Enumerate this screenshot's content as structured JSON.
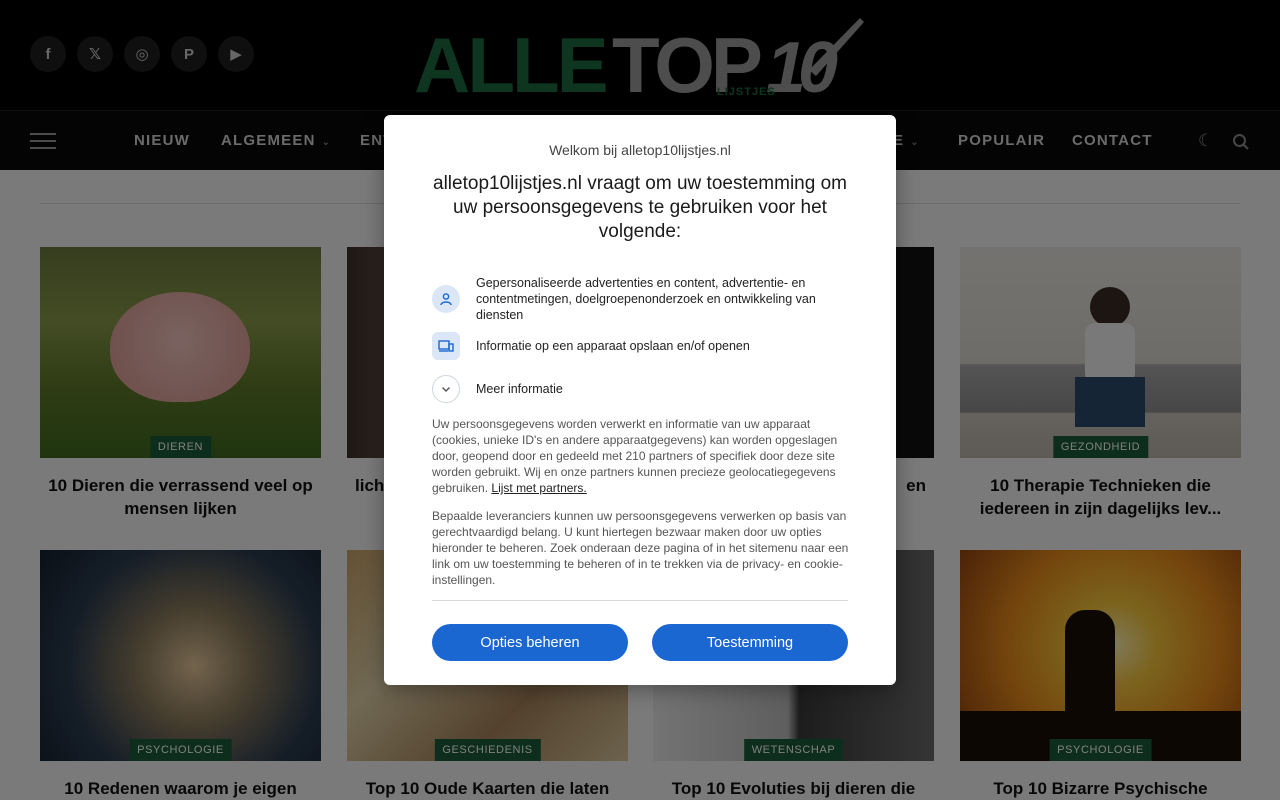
{
  "header": {
    "social": [
      {
        "icon": "facebook-icon",
        "glyph": "f"
      },
      {
        "icon": "x-twitter-icon",
        "glyph": "𝕏"
      },
      {
        "icon": "instagram-icon",
        "glyph": "◎"
      },
      {
        "icon": "pinterest-icon",
        "glyph": "P"
      },
      {
        "icon": "youtube-icon",
        "glyph": "▶"
      }
    ],
    "logo": {
      "part1": "ALLE",
      "part2": "TOP",
      "part3": "10",
      "sub": "LIJSTJES",
      "color_green": "#1d6b3f",
      "color_grey": "#9a9a9a"
    }
  },
  "nav": {
    "items": [
      "NIEUW",
      "ALGEMEEN",
      "ENT",
      "E",
      "POPULAIR",
      "CONTACT"
    ],
    "dark_mode_icon": "moon-icon",
    "search_icon": "search-icon"
  },
  "cards": [
    {
      "category": "DIEREN",
      "title": "10 Dieren die verrassend veel op mensen lijken"
    },
    {
      "category": "",
      "title": "lich"
    },
    {
      "category": "",
      "title": "en"
    },
    {
      "category": "GEZONDHEID",
      "title": "10 Therapie Technieken die iedereen in zijn dagelijks lev..."
    },
    {
      "category": "PSYCHOLOGIE",
      "title": "10 Redenen waarom je eigen"
    },
    {
      "category": "GESCHIEDENIS",
      "title": "Top 10 Oude Kaarten die laten"
    },
    {
      "category": "WETENSCHAP",
      "title": "Top 10 Evoluties bij dieren die"
    },
    {
      "category": "PSYCHOLOGIE",
      "title": "Top 10 Bizarre Psychische"
    }
  ],
  "consent": {
    "welcome": "Welkom bij alletop10lijstjes.nl",
    "heading": "alletop10lijstjes.nl vraagt om uw toestemming om uw persoonsgegevens te gebruiken voor het volgende:",
    "purposes": [
      {
        "icon": "person-icon",
        "text": "Gepersonaliseerde advertenties en content, advertentie- en contentmetingen, doelgroepenonderzoek en ontwikkeling van diensten"
      },
      {
        "icon": "devices-icon",
        "text": "Informatie op een apparaat opslaan en/of openen"
      },
      {
        "icon": "chevron-down-icon",
        "text": "Meer informatie"
      }
    ],
    "body1": "Uw persoonsgegevens worden verwerkt en informatie van uw apparaat (cookies, unieke ID's en andere apparaatgegevens) kan worden opgeslagen door, geopend door en gedeeld met 210 partners of specifiek door deze site worden gebruikt. Wij en onze partners kunnen precieze geolocatiegegevens gebruiken.",
    "partners_link": "Lijst met partners.",
    "body2": "Bepaalde leveranciers kunnen uw persoonsgegevens verwerken op basis van gerechtvaardigd belang. U kunt hiertegen bezwaar maken door uw opties hieronder te beheren. Zoek onderaan deze pagina of in het sitemenu naar een link om uw toestemming te beheren of in te trekken via de privacy- en cookie-instellingen.",
    "manage_button": "Opties beheren",
    "consent_button": "Toestemming",
    "accent": "#1a67d2"
  }
}
